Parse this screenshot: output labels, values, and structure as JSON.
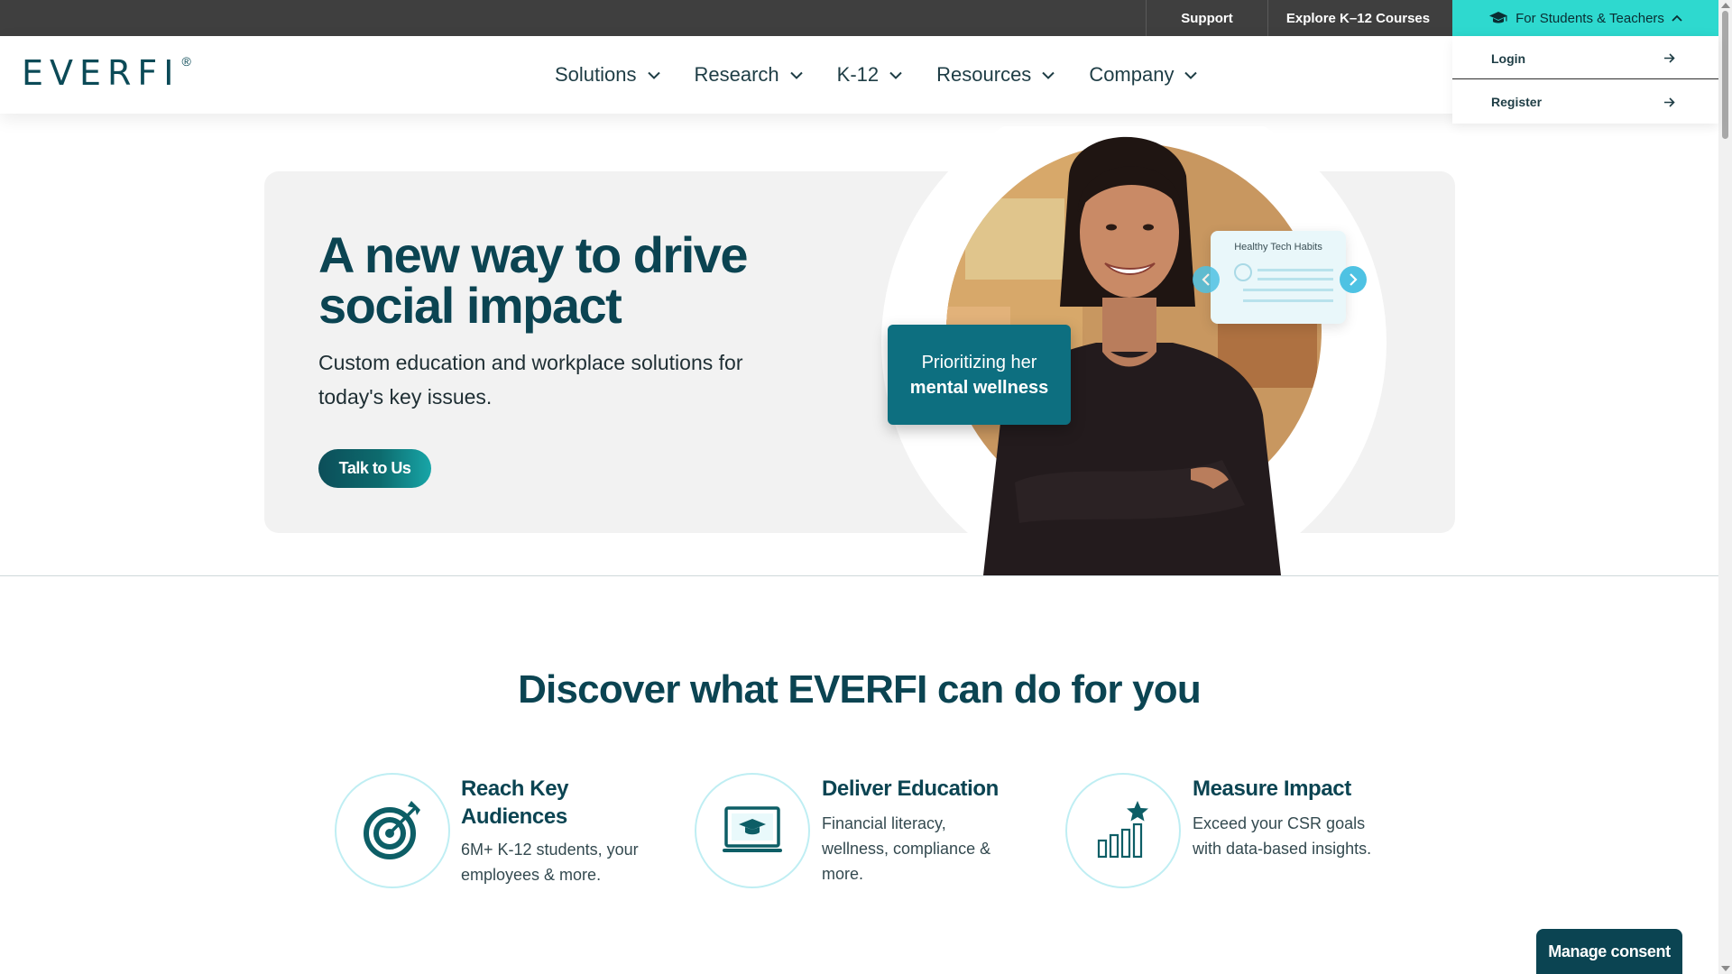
{
  "utility": {
    "support": "Support",
    "explore": "Explore K–12 Courses",
    "students": "For Students & Teachers"
  },
  "dropdown": {
    "login": "Login",
    "register": "Register"
  },
  "logo": {
    "text": "EVERFI",
    "reg": "®"
  },
  "nav": {
    "items": [
      {
        "label": "Solutions"
      },
      {
        "label": "Research"
      },
      {
        "label": "K-12"
      },
      {
        "label": "Resources"
      },
      {
        "label": "Company"
      }
    ]
  },
  "hero": {
    "title": "A new way to drive social impact",
    "subtitle": "Custom education and workplace solutions for today's key issues.",
    "cta": "Talk to Us",
    "card_tech_label": "Healthy Tech Habits",
    "card_wellness_line1": "Prioritizing her",
    "card_wellness_line2": "mental wellness"
  },
  "discover": {
    "title": "Discover what EVERFI can do for you",
    "features": [
      {
        "title": "Reach Key Audiences",
        "text": "6M+ K-12 students, your employees & more.",
        "icon": "target-icon"
      },
      {
        "title": "Deliver Education",
        "text": "Financial literacy, wellness, compliance & more.",
        "icon": "laptop-graduation-icon"
      },
      {
        "title": "Measure Impact",
        "text": "Exceed your CSR goals with data-based insights.",
        "icon": "bar-chart-star-icon"
      }
    ]
  },
  "consent": {
    "label": "Manage consent"
  },
  "colors": {
    "brand_dark": "#0b4452",
    "accent_teal": "#2ed9cf",
    "utility_bar": "#3f3f3f",
    "hero_bg": "#f2f2f2"
  }
}
